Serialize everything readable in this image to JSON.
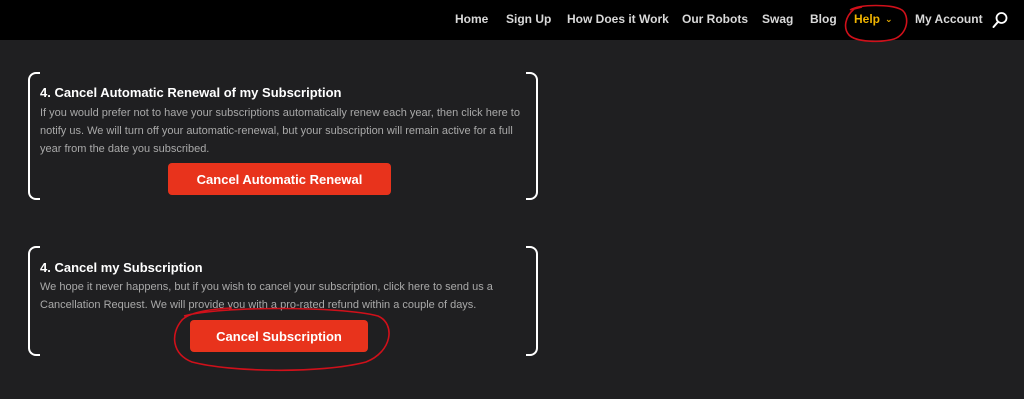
{
  "nav": {
    "items": [
      {
        "label": "Home"
      },
      {
        "label": "Sign Up"
      },
      {
        "label": "How Does it Work"
      },
      {
        "label": "Our Robots"
      },
      {
        "label": "Swag"
      },
      {
        "label": "Blog"
      },
      {
        "label": "Help"
      },
      {
        "label": "My Account"
      }
    ],
    "active_item": "Help",
    "search_icon": "search-icon"
  },
  "cards": [
    {
      "title": "4. Cancel Automatic Renewal of my Subscription",
      "body": "If you would prefer not to have your subscriptions automatically renew each year, then click here to notify us. We will turn off your automatic-renewal, but your subscription will remain active for a full year from the date you subscribed.",
      "button_label": "Cancel Automatic Renewal"
    },
    {
      "title": "4. Cancel my Subscription",
      "body": "We hope it never happens, but if you wish to cancel your subscription, click here to send us a Cancellation Request. We will provide you with a pro-rated refund within a couple of days.",
      "button_label": "Cancel Subscription"
    }
  ],
  "colors": {
    "background": "#1f1f21",
    "topbar": "#000000",
    "accent_button": "#e8331c",
    "active_nav": "#f0b400",
    "annotation": "#d0101a"
  }
}
